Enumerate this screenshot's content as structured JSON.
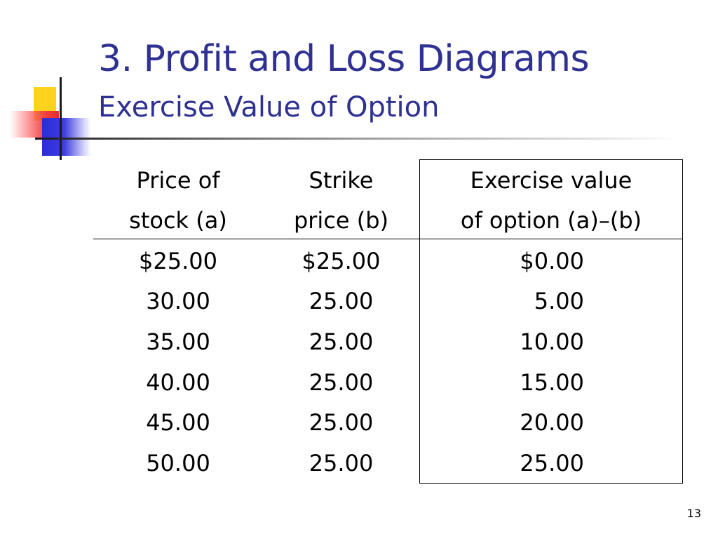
{
  "slide": {
    "title": "3. Profit and Loss Diagrams",
    "subtitle": "Exercise Value of Option",
    "page_number": "13"
  },
  "table": {
    "headers": [
      [
        "Price of",
        "stock (a)"
      ],
      [
        "Strike",
        "price (b)"
      ],
      [
        "Exercise value",
        "of option (a)–(b)"
      ]
    ],
    "rows": [
      [
        "$25.00",
        "$25.00",
        "$0.00"
      ],
      [
        "30.00",
        "25.00",
        "5.00"
      ],
      [
        "35.00",
        "25.00",
        "10.00"
      ],
      [
        "40.00",
        "25.00",
        "15.00"
      ],
      [
        "45.00",
        "25.00",
        "20.00"
      ],
      [
        "50.00",
        "25.00",
        "25.00"
      ]
    ]
  },
  "colors": {
    "title": "#2e3192",
    "ornament_yellow": "#ffd21e",
    "ornament_blue": "#2b2bd9",
    "ornament_red": "#f03c3c"
  }
}
